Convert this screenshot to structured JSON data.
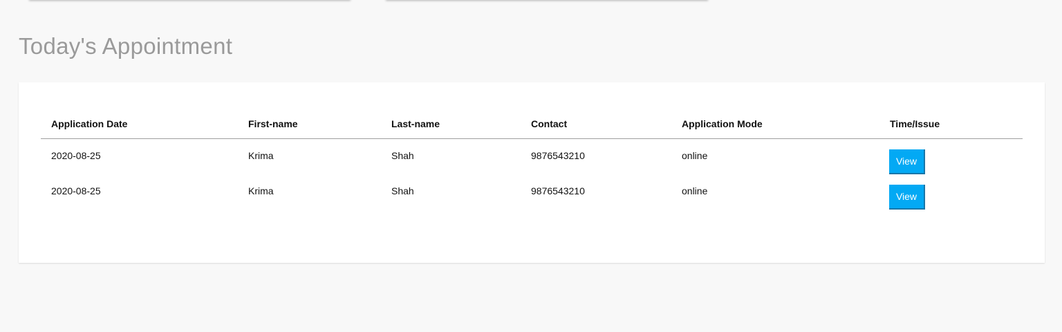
{
  "page": {
    "title": "Today's Appointment"
  },
  "table": {
    "headers": {
      "application_date": "Application Date",
      "first_name": "First-name",
      "last_name": "Last-name",
      "contact": "Contact",
      "application_mode": "Application Mode",
      "time_issue": "Time/Issue"
    },
    "rows": [
      {
        "application_date": "2020-08-25",
        "first_name": "Krima",
        "last_name": "Shah",
        "contact": "9876543210",
        "application_mode": "online",
        "action_label": "View"
      },
      {
        "application_date": "2020-08-25",
        "first_name": "Krima",
        "last_name": "Shah",
        "contact": "9876543210",
        "application_mode": "online",
        "action_label": "View"
      }
    ]
  },
  "colors": {
    "accent_button": "#03a9f4",
    "title_text": "#9a9a9a",
    "page_background": "#f8f8f8"
  }
}
